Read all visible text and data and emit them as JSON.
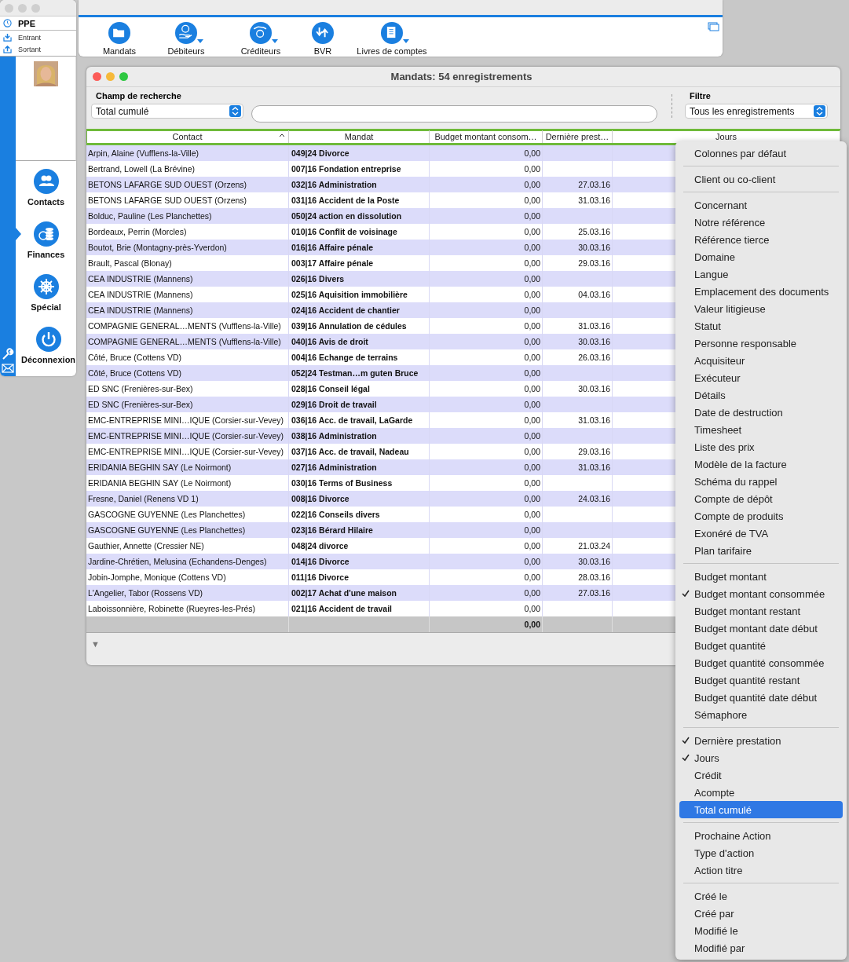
{
  "sidebar": {
    "title": "PPE",
    "links": [
      {
        "label": "Entrant",
        "kind": "in"
      },
      {
        "label": "Sortant",
        "kind": "out"
      }
    ],
    "nav": [
      {
        "label": "Contacts",
        "kind": "contacts",
        "selected": false
      },
      {
        "label": "Finances",
        "kind": "finances",
        "selected": true
      },
      {
        "label": "Spécial",
        "kind": "wheel",
        "selected": false
      },
      {
        "label": "Déconnexion",
        "kind": "power",
        "selected": false
      }
    ]
  },
  "toolbar": {
    "buttons": [
      {
        "label": "Mandats",
        "kind": "folder",
        "menu": false
      },
      {
        "label": "Débiteurs",
        "kind": "coin-hand",
        "menu": true
      },
      {
        "label": "Créditeurs",
        "kind": "hand-coin",
        "menu": true
      },
      {
        "label": "BVR",
        "kind": "arrows",
        "menu": false
      },
      {
        "label": "Livres de comptes",
        "kind": "book",
        "menu": true
      }
    ]
  },
  "window": {
    "title": "Mandats: 54 enregistrements",
    "search": {
      "label": "Champ de recherche",
      "field": "Total cumulé"
    },
    "filter": {
      "label": "Filtre",
      "value": "Tous les enregistrements"
    }
  },
  "table": {
    "highlighted": true,
    "columns": [
      {
        "label": "Contact",
        "sorted": true
      },
      {
        "label": "Mandat",
        "sorted": false
      },
      {
        "label": "Budget montant consom…",
        "sorted": false
      },
      {
        "label": "Dernière prest…",
        "sorted": false
      },
      {
        "label": "Jours",
        "sorted": false
      }
    ],
    "rows": [
      {
        "contact": "Arpin, Alaine (Vufflens-la-Ville)",
        "mandat": "049|24 Divorce",
        "budget": "0,00"
      },
      {
        "contact": "Bertrand, Lowell (La Brévine)",
        "mandat": "007|16 Fondation entreprise",
        "budget": "0,00"
      },
      {
        "contact": "BETONS LAFARGE SUD OUEST (Orzens)",
        "mandat": "032|16 Administration",
        "budget": "0,00",
        "derniere": "27.03.16"
      },
      {
        "contact": "BETONS LAFARGE SUD OUEST (Orzens)",
        "mandat": "031|16 Accident de la Poste",
        "budget": "0,00",
        "derniere": "31.03.16"
      },
      {
        "contact": "Bolduc, Pauline (Les Planchettes)",
        "mandat": "050|24 action en dissolution",
        "budget": "0,00"
      },
      {
        "contact": "Bordeaux, Perrin (Morcles)",
        "mandat": "010|16 Conflit de voisinage",
        "budget": "0,00",
        "derniere": "25.03.16"
      },
      {
        "contact": "Boutot, Brie (Montagny-près-Yverdon)",
        "mandat": "016|16 Affaire pénale",
        "budget": "0,00",
        "derniere": "30.03.16"
      },
      {
        "contact": "Brault, Pascal (Blonay)",
        "mandat": "003|17 Affaire pénale",
        "budget": "0,00",
        "derniere": "29.03.16"
      },
      {
        "contact": "CEA INDUSTRIE (Mannens)",
        "mandat": "026|16 Divers",
        "budget": "0,00"
      },
      {
        "contact": "CEA INDUSTRIE (Mannens)",
        "mandat": "025|16 Aquisition immobilière",
        "budget": "0,00",
        "derniere": "04.03.16"
      },
      {
        "contact": "CEA INDUSTRIE (Mannens)",
        "mandat": "024|16 Accident de chantier",
        "budget": "0,00"
      },
      {
        "contact": "COMPAGNIE GENERAL…MENTS (Vufflens-la-Ville)",
        "mandat": "039|16 Annulation de cédules",
        "budget": "0,00",
        "derniere": "31.03.16"
      },
      {
        "contact": "COMPAGNIE GENERAL…MENTS (Vufflens-la-Ville)",
        "mandat": "040|16 Avis de droit",
        "budget": "0,00",
        "derniere": "30.03.16"
      },
      {
        "contact": "Côté, Bruce (Cottens VD)",
        "mandat": "004|16 Echange de terrains",
        "budget": "0,00",
        "derniere": "26.03.16"
      },
      {
        "contact": "Côté, Bruce (Cottens VD)",
        "mandat": "052|24 Testman…m guten Bruce",
        "budget": "0,00"
      },
      {
        "contact": "ED SNC (Frenières-sur-Bex)",
        "mandat": "028|16 Conseil légal",
        "budget": "0,00",
        "derniere": "30.03.16"
      },
      {
        "contact": "ED SNC (Frenières-sur-Bex)",
        "mandat": "029|16 Droit de travail",
        "budget": "0,00"
      },
      {
        "contact": "EMC-ENTREPRISE MINI…IQUE (Corsier-sur-Vevey)",
        "mandat": "036|16 Acc. de travail, LaGarde",
        "budget": "0,00",
        "derniere": "31.03.16"
      },
      {
        "contact": "EMC-ENTREPRISE MINI…IQUE (Corsier-sur-Vevey)",
        "mandat": "038|16 Administration",
        "budget": "0,00"
      },
      {
        "contact": "EMC-ENTREPRISE MINI…IQUE (Corsier-sur-Vevey)",
        "mandat": "037|16 Acc. de travail, Nadeau",
        "budget": "0,00",
        "derniere": "29.03.16"
      },
      {
        "contact": "ERIDANIA BEGHIN SAY (Le Noirmont)",
        "mandat": "027|16 Administration",
        "budget": "0,00",
        "derniere": "31.03.16"
      },
      {
        "contact": "ERIDANIA BEGHIN SAY (Le Noirmont)",
        "mandat": "030|16 Terms of Business",
        "budget": "0,00"
      },
      {
        "contact": "Fresne, Daniel (Renens VD 1)",
        "mandat": "008|16 Divorce",
        "budget": "0,00",
        "derniere": "24.03.16"
      },
      {
        "contact": "GASCOGNE GUYENNE (Les Planchettes)",
        "mandat": "022|16 Conseils divers",
        "budget": "0,00"
      },
      {
        "contact": "GASCOGNE GUYENNE (Les Planchettes)",
        "mandat": "023|16 Bérard Hilaire",
        "budget": "0,00"
      },
      {
        "contact": "Gauthier, Annette (Cressier NE)",
        "mandat": "048|24 divorce",
        "budget": "0,00",
        "derniere": "21.03.24"
      },
      {
        "contact": "Jardine-Chrétien, Melusina (Echandens-Denges)",
        "mandat": "014|16 Divorce",
        "budget": "0,00",
        "derniere": "30.03.16"
      },
      {
        "contact": "Jobin-Jomphe, Monique (Cottens VD)",
        "mandat": "011|16 Divorce",
        "budget": "0,00",
        "derniere": "28.03.16"
      },
      {
        "contact": "L'Angelier, Tabor (Rossens VD)",
        "mandat": "002|17 Achat d'une maison",
        "budget": "0,00",
        "derniere": "27.03.16"
      },
      {
        "contact": "Laboissonnière, Robinette (Rueyres-les-Prés)",
        "mandat": "021|16 Accident de travail",
        "budget": "0,00"
      }
    ],
    "totals": {
      "budget": "0,00"
    }
  },
  "footer": {
    "toggle": "▼"
  },
  "menu": {
    "groups": [
      [
        {
          "label": "Colonnes par défaut",
          "checked": false,
          "selected": false
        }
      ],
      [
        {
          "label": "Client ou co-client",
          "checked": false,
          "selected": false
        }
      ],
      [
        {
          "label": "Concernant",
          "checked": false,
          "selected": false
        },
        {
          "label": "Notre référence",
          "checked": false,
          "selected": false
        },
        {
          "label": "Référence tierce",
          "checked": false,
          "selected": false
        },
        {
          "label": "Domaine",
          "checked": false,
          "selected": false
        },
        {
          "label": "Langue",
          "checked": false,
          "selected": false
        },
        {
          "label": "Emplacement des documents",
          "checked": false,
          "selected": false
        },
        {
          "label": "Valeur litigieuse",
          "checked": false,
          "selected": false
        },
        {
          "label": "Statut",
          "checked": false,
          "selected": false
        },
        {
          "label": "Personne responsable",
          "checked": false,
          "selected": false
        },
        {
          "label": "Acquisiteur",
          "checked": false,
          "selected": false
        },
        {
          "label": "Exécuteur",
          "checked": false,
          "selected": false
        },
        {
          "label": "Détails",
          "checked": false,
          "selected": false
        },
        {
          "label": "Date de destruction",
          "checked": false,
          "selected": false
        },
        {
          "label": "Timesheet",
          "checked": false,
          "selected": false
        },
        {
          "label": "Liste des prix",
          "checked": false,
          "selected": false
        },
        {
          "label": "Modèle de la facture",
          "checked": false,
          "selected": false
        },
        {
          "label": "Schéma du rappel",
          "checked": false,
          "selected": false
        },
        {
          "label": "Compte de dépôt",
          "checked": false,
          "selected": false
        },
        {
          "label": "Compte de produits",
          "checked": false,
          "selected": false
        },
        {
          "label": "Exonéré de TVA",
          "checked": false,
          "selected": false
        },
        {
          "label": "Plan tarifaire",
          "checked": false,
          "selected": false
        }
      ],
      [
        {
          "label": "Budget montant",
          "checked": false,
          "selected": false
        },
        {
          "label": "Budget montant consommée",
          "checked": true,
          "selected": false
        },
        {
          "label": "Budget montant restant",
          "checked": false,
          "selected": false
        },
        {
          "label": "Budget montant date début",
          "checked": false,
          "selected": false
        },
        {
          "label": "Budget quantité",
          "checked": false,
          "selected": false
        },
        {
          "label": "Budget quantité consommée",
          "checked": false,
          "selected": false
        },
        {
          "label": "Budget quantité restant",
          "checked": false,
          "selected": false
        },
        {
          "label": "Budget quantité date début",
          "checked": false,
          "selected": false
        },
        {
          "label": "Sémaphore",
          "checked": false,
          "selected": false
        }
      ],
      [
        {
          "label": "Dernière prestation",
          "checked": true,
          "selected": false
        },
        {
          "label": "Jours",
          "checked": true,
          "selected": false
        },
        {
          "label": "Crédit",
          "checked": false,
          "selected": false
        },
        {
          "label": "Acompte",
          "checked": false,
          "selected": false
        },
        {
          "label": "Total cumulé",
          "checked": false,
          "selected": true
        }
      ],
      [
        {
          "label": "Prochaine Action",
          "checked": false,
          "selected": false
        },
        {
          "label": "Type d'action",
          "checked": false,
          "selected": false
        },
        {
          "label": "Action titre",
          "checked": false,
          "selected": false
        }
      ],
      [
        {
          "label": "Créé le",
          "checked": false,
          "selected": false
        },
        {
          "label": "Créé par",
          "checked": false,
          "selected": false
        },
        {
          "label": "Modifié le",
          "checked": false,
          "selected": false
        },
        {
          "label": "Modifié par",
          "checked": false,
          "selected": false
        }
      ]
    ]
  }
}
